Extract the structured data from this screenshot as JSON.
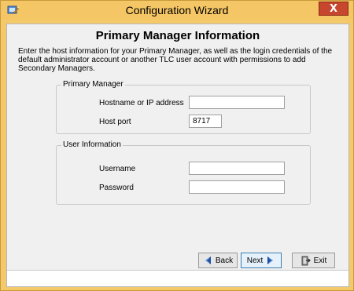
{
  "window": {
    "title": "Configuration Wizard",
    "close_glyph": "X",
    "icon": "wizard-app-icon"
  },
  "page": {
    "heading": "Primary Manager Information",
    "description": "Enter the host information for your Primary Manager, as well as the login credentials of the default administrator account or another TLC user account with permissions to add Secondary Managers."
  },
  "primary_manager": {
    "group_label": "Primary Manager",
    "hostname_label": "Hostname or IP address",
    "hostname_value": "",
    "port_label": "Host port",
    "port_value": "8717"
  },
  "user_info": {
    "group_label": "User Information",
    "username_label": "Username",
    "username_value": "",
    "password_label": "Password",
    "password_value": ""
  },
  "buttons": {
    "back": "Back",
    "next": "Next",
    "exit": "Exit",
    "back_icon": "arrow-left-icon",
    "next_icon": "arrow-right-icon",
    "exit_icon": "exit-door-icon"
  },
  "colors": {
    "titlebar": "#f5c665",
    "close": "#c7462e",
    "arrow": "#1f4e9c"
  }
}
